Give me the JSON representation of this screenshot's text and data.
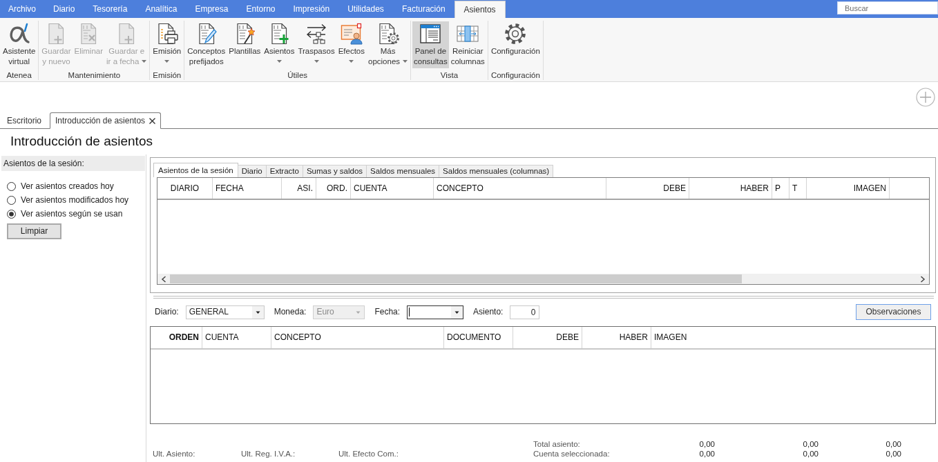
{
  "menu_tabs": [
    {
      "label": "Archivo",
      "selected": false
    },
    {
      "label": "Diario",
      "selected": false
    },
    {
      "label": "Tesorería",
      "selected": false
    },
    {
      "label": "Analítica",
      "selected": false
    },
    {
      "label": "Empresa",
      "selected": false
    },
    {
      "label": "Entorno",
      "selected": false
    },
    {
      "label": "Impresión",
      "selected": false
    },
    {
      "label": "Utilidades",
      "selected": false
    },
    {
      "label": "Facturación",
      "selected": false
    },
    {
      "label": "Asientos",
      "selected": true
    }
  ],
  "search": {
    "placeholder": "Buscar"
  },
  "ribbon_groups": [
    {
      "label": "Atenea",
      "buttons": [
        {
          "lines": [
            "Asistente",
            "virtual"
          ],
          "disabled": false,
          "selected": false,
          "dropdown": false
        }
      ]
    },
    {
      "label": "Mantenimiento",
      "buttons": [
        {
          "lines": [
            "Guardar",
            "y nuevo"
          ],
          "disabled": true,
          "selected": false,
          "dropdown": false
        },
        {
          "lines": [
            "Eliminar"
          ],
          "disabled": true,
          "selected": false,
          "dropdown": false
        },
        {
          "lines": [
            "Guardar e",
            "ir a fecha"
          ],
          "disabled": true,
          "selected": false,
          "dropdown": true
        }
      ]
    },
    {
      "label": "Emisión",
      "buttons": [
        {
          "lines": [
            "Emisión"
          ],
          "disabled": false,
          "selected": false,
          "dropdown": true
        }
      ]
    },
    {
      "label": "Útiles",
      "buttons": [
        {
          "lines": [
            "Conceptos",
            "prefijados"
          ],
          "disabled": false,
          "selected": false,
          "dropdown": false
        },
        {
          "lines": [
            "Plantillas"
          ],
          "disabled": false,
          "selected": false,
          "dropdown": false
        },
        {
          "lines": [
            "Asientos"
          ],
          "disabled": false,
          "selected": false,
          "dropdown": true
        },
        {
          "lines": [
            "Traspasos"
          ],
          "disabled": false,
          "selected": false,
          "dropdown": true
        },
        {
          "lines": [
            "Efectos"
          ],
          "disabled": false,
          "selected": false,
          "dropdown": true
        },
        {
          "lines": [
            "Más",
            "opciones"
          ],
          "disabled": false,
          "selected": false,
          "dropdown": true
        }
      ]
    },
    {
      "label": "Vista",
      "buttons": [
        {
          "lines": [
            "Panel de",
            "consultas"
          ],
          "disabled": false,
          "selected": true,
          "dropdown": false
        },
        {
          "lines": [
            "Reiniciar",
            "columnas"
          ],
          "disabled": false,
          "selected": false,
          "dropdown": false
        }
      ]
    },
    {
      "label": "Configuración",
      "buttons": [
        {
          "lines": [
            "Configuración"
          ],
          "disabled": false,
          "selected": false,
          "dropdown": false
        }
      ]
    }
  ],
  "document_tabs": [
    {
      "label": "Escritorio",
      "selected": false,
      "closable": false
    },
    {
      "label": "Introducción de asientos",
      "selected": true,
      "closable": true
    }
  ],
  "page_title": "Introducción de asientos",
  "session_panel": {
    "title": "Asientos de la sesión:",
    "options": [
      {
        "label": "Ver asientos creados hoy",
        "selected": false
      },
      {
        "label": "Ver asientos modificados hoy",
        "selected": false
      },
      {
        "label": "Ver asientos según se usan",
        "selected": true
      }
    ],
    "button": "Limpiar"
  },
  "query_panel": {
    "tabs": [
      {
        "label": "Asientos de la sesión",
        "selected": true
      },
      {
        "label": "Diario",
        "selected": false
      },
      {
        "label": "Extracto",
        "selected": false
      },
      {
        "label": "Sumas y saldos",
        "selected": false
      },
      {
        "label": "Saldos mensuales",
        "selected": false
      },
      {
        "label": "Saldos mensuales (columnas)",
        "selected": false
      }
    ],
    "columns": [
      "DIARIO",
      "FECHA",
      "ASI.",
      "ORD.",
      "CUENTA",
      "CONCEPTO",
      "DEBE",
      "HABER",
      "P",
      "T",
      "IMAGEN"
    ]
  },
  "entry_form": {
    "fields": [
      {
        "label": "Diario:",
        "kind": "select",
        "value": "GENERAL",
        "disabled": false,
        "focused": false
      },
      {
        "label": "Moneda:",
        "kind": "select",
        "value": "Euro",
        "disabled": true,
        "focused": false
      },
      {
        "label": "Fecha:",
        "kind": "select",
        "disabled": false,
        "focused": true
      },
      {
        "label": "Asiento:",
        "kind": "number",
        "value": "0",
        "disabled": false,
        "focused": false
      }
    ],
    "button": "Observaciones"
  },
  "lines_table": {
    "columns": [
      {
        "label": "ORDEN",
        "sorted": true
      },
      {
        "label": "CUENTA",
        "sorted": false
      },
      {
        "label": "CONCEPTO",
        "sorted": false
      },
      {
        "label": "DOCUMENTO",
        "sorted": false
      },
      {
        "label": "DEBE",
        "sorted": false
      },
      {
        "label": "HABER",
        "sorted": false
      },
      {
        "label": "IMAGEN",
        "sorted": false
      }
    ]
  },
  "footer": {
    "last_items": [
      "Ult. Asiento:",
      "Ult. Reg. I.V.A.:",
      "Ult. Efecto Com.:"
    ],
    "totals": [
      {
        "label": "Total asiento:",
        "values": [
          "0,00",
          "0,00",
          "0,00"
        ]
      },
      {
        "label": "Cuenta seleccionada:",
        "values": [
          "0,00",
          "0,00",
          "0,00"
        ]
      }
    ]
  }
}
